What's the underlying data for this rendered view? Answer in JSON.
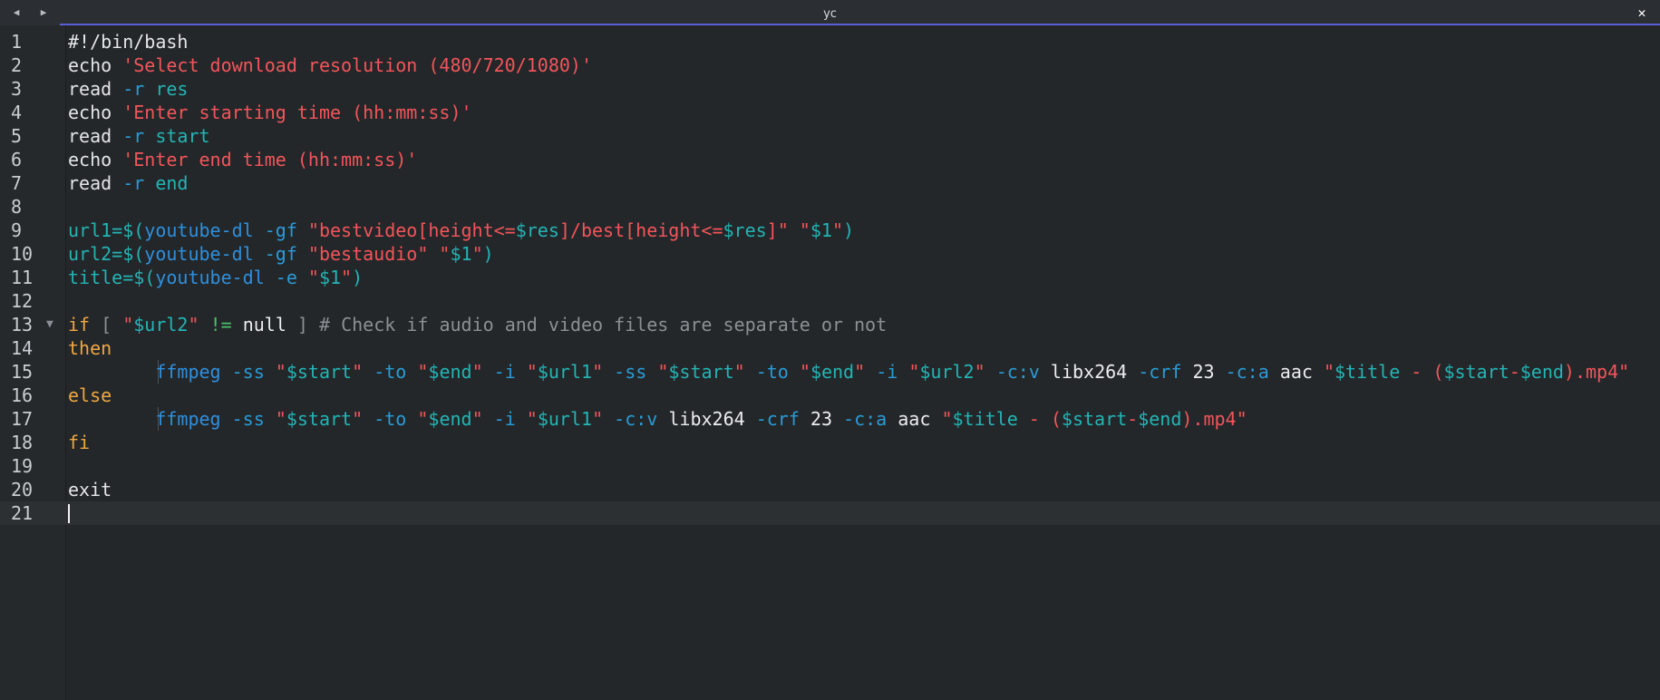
{
  "window": {
    "tab_title": "yc",
    "back_icon": "◀",
    "forward_icon": "▶",
    "close_icon": "✕"
  },
  "colors": {
    "keyword": "#f0a742",
    "string": "#f2555a",
    "variable": "#24b4b4",
    "builtin": "#2f8fdc",
    "option": "#2a9bd6",
    "comment": "#8b9095",
    "accent": "#5b5fd6"
  },
  "editor": {
    "current_line": 21,
    "lines": [
      {
        "n": "1",
        "tokens": [
          {
            "t": "#!/bin/bash",
            "c": "g"
          }
        ]
      },
      {
        "n": "2",
        "tokens": [
          {
            "t": "echo ",
            "c": "g"
          },
          {
            "t": "'Select download resolution (480/720/1080)'",
            "c": "s"
          }
        ]
      },
      {
        "n": "3",
        "tokens": [
          {
            "t": "read ",
            "c": "g"
          },
          {
            "t": "-r ",
            "c": "o"
          },
          {
            "t": "res",
            "c": "v"
          }
        ]
      },
      {
        "n": "4",
        "tokens": [
          {
            "t": "echo ",
            "c": "g"
          },
          {
            "t": "'Enter starting time (hh:mm:ss)'",
            "c": "s"
          }
        ]
      },
      {
        "n": "5",
        "tokens": [
          {
            "t": "read ",
            "c": "g"
          },
          {
            "t": "-r ",
            "c": "o"
          },
          {
            "t": "start",
            "c": "v"
          }
        ]
      },
      {
        "n": "6",
        "tokens": [
          {
            "t": "echo ",
            "c": "g"
          },
          {
            "t": "'Enter end time (hh:mm:ss)'",
            "c": "s"
          }
        ]
      },
      {
        "n": "7",
        "tokens": [
          {
            "t": "read ",
            "c": "g"
          },
          {
            "t": "-r ",
            "c": "o"
          },
          {
            "t": "end",
            "c": "v"
          }
        ]
      },
      {
        "n": "8",
        "tokens": []
      },
      {
        "n": "9",
        "tokens": [
          {
            "t": "url1=$(",
            "c": "v"
          },
          {
            "t": "youtube-dl ",
            "c": "b"
          },
          {
            "t": "-gf ",
            "c": "o"
          },
          {
            "t": "\"bestvideo[height<=",
            "c": "s"
          },
          {
            "t": "$res",
            "c": "v"
          },
          {
            "t": "]/best[height<=",
            "c": "s"
          },
          {
            "t": "$res",
            "c": "v"
          },
          {
            "t": "]\" \"",
            "c": "s"
          },
          {
            "t": "$1",
            "c": "v"
          },
          {
            "t": "\"",
            "c": "s"
          },
          {
            "t": ")",
            "c": "v"
          }
        ]
      },
      {
        "n": "10",
        "tokens": [
          {
            "t": "url2=$(",
            "c": "v"
          },
          {
            "t": "youtube-dl ",
            "c": "b"
          },
          {
            "t": "-gf ",
            "c": "o"
          },
          {
            "t": "\"bestaudio\" \"",
            "c": "s"
          },
          {
            "t": "$1",
            "c": "v"
          },
          {
            "t": "\"",
            "c": "s"
          },
          {
            "t": ")",
            "c": "v"
          }
        ]
      },
      {
        "n": "11",
        "tokens": [
          {
            "t": "title=$(",
            "c": "v"
          },
          {
            "t": "youtube-dl ",
            "c": "b"
          },
          {
            "t": "-e ",
            "c": "o"
          },
          {
            "t": "\"",
            "c": "s"
          },
          {
            "t": "$1",
            "c": "v"
          },
          {
            "t": "\"",
            "c": "s"
          },
          {
            "t": ")",
            "c": "v"
          }
        ]
      },
      {
        "n": "12",
        "tokens": []
      },
      {
        "n": "13",
        "fold": true,
        "tokens": [
          {
            "t": "if",
            "c": "k"
          },
          {
            "t": " [ ",
            "c": "c"
          },
          {
            "t": "\"",
            "c": "s"
          },
          {
            "t": "$url2",
            "c": "v"
          },
          {
            "t": "\" ",
            "c": "s"
          },
          {
            "t": "!= ",
            "c": "p"
          },
          {
            "t": "null",
            "c": "t"
          },
          {
            "t": " ] # Check if audio and video files are separate or not",
            "c": "c"
          }
        ]
      },
      {
        "n": "14",
        "tokens": [
          {
            "t": "then",
            "c": "k"
          }
        ]
      },
      {
        "n": "15",
        "guide": true,
        "tokens": [
          {
            "t": "\t",
            "c": "g"
          },
          {
            "t": "ffmpeg ",
            "c": "b"
          },
          {
            "t": "-ss ",
            "c": "o"
          },
          {
            "t": "\"",
            "c": "s"
          },
          {
            "t": "$start",
            "c": "v"
          },
          {
            "t": "\" ",
            "c": "s"
          },
          {
            "t": "-to ",
            "c": "o"
          },
          {
            "t": "\"",
            "c": "s"
          },
          {
            "t": "$end",
            "c": "v"
          },
          {
            "t": "\" ",
            "c": "s"
          },
          {
            "t": "-i ",
            "c": "o"
          },
          {
            "t": "\"",
            "c": "s"
          },
          {
            "t": "$url1",
            "c": "v"
          },
          {
            "t": "\" ",
            "c": "s"
          },
          {
            "t": "-ss ",
            "c": "o"
          },
          {
            "t": "\"",
            "c": "s"
          },
          {
            "t": "$start",
            "c": "v"
          },
          {
            "t": "\" ",
            "c": "s"
          },
          {
            "t": "-to ",
            "c": "o"
          },
          {
            "t": "\"",
            "c": "s"
          },
          {
            "t": "$end",
            "c": "v"
          },
          {
            "t": "\" ",
            "c": "s"
          },
          {
            "t": "-i ",
            "c": "o"
          },
          {
            "t": "\"",
            "c": "s"
          },
          {
            "t": "$url2",
            "c": "v"
          },
          {
            "t": "\" ",
            "c": "s"
          },
          {
            "t": "-c:v ",
            "c": "o"
          },
          {
            "t": "libx264 ",
            "c": "t"
          },
          {
            "t": "-crf ",
            "c": "o"
          },
          {
            "t": "23 ",
            "c": "t"
          },
          {
            "t": "-c:a ",
            "c": "o"
          },
          {
            "t": "aac ",
            "c": "t"
          },
          {
            "t": "\"",
            "c": "s"
          },
          {
            "t": "$title",
            "c": "v"
          },
          {
            "t": " - (",
            "c": "s"
          },
          {
            "t": "$start",
            "c": "v"
          },
          {
            "t": "-",
            "c": "s"
          },
          {
            "t": "$end",
            "c": "v"
          },
          {
            "t": ").mp4\"",
            "c": "s"
          }
        ]
      },
      {
        "n": "16",
        "tokens": [
          {
            "t": "else",
            "c": "k"
          }
        ]
      },
      {
        "n": "17",
        "guide": true,
        "tokens": [
          {
            "t": "\t",
            "c": "g"
          },
          {
            "t": "ffmpeg ",
            "c": "b"
          },
          {
            "t": "-ss ",
            "c": "o"
          },
          {
            "t": "\"",
            "c": "s"
          },
          {
            "t": "$start",
            "c": "v"
          },
          {
            "t": "\" ",
            "c": "s"
          },
          {
            "t": "-to ",
            "c": "o"
          },
          {
            "t": "\"",
            "c": "s"
          },
          {
            "t": "$end",
            "c": "v"
          },
          {
            "t": "\" ",
            "c": "s"
          },
          {
            "t": "-i ",
            "c": "o"
          },
          {
            "t": "\"",
            "c": "s"
          },
          {
            "t": "$url1",
            "c": "v"
          },
          {
            "t": "\" ",
            "c": "s"
          },
          {
            "t": "-c:v ",
            "c": "o"
          },
          {
            "t": "libx264 ",
            "c": "t"
          },
          {
            "t": "-crf ",
            "c": "o"
          },
          {
            "t": "23 ",
            "c": "t"
          },
          {
            "t": "-c:a ",
            "c": "o"
          },
          {
            "t": "aac ",
            "c": "t"
          },
          {
            "t": "\"",
            "c": "s"
          },
          {
            "t": "$title",
            "c": "v"
          },
          {
            "t": " - (",
            "c": "s"
          },
          {
            "t": "$start",
            "c": "v"
          },
          {
            "t": "-",
            "c": "s"
          },
          {
            "t": "$end",
            "c": "v"
          },
          {
            "t": ").mp4\"",
            "c": "s"
          }
        ]
      },
      {
        "n": "18",
        "tokens": [
          {
            "t": "fi",
            "c": "k"
          }
        ]
      },
      {
        "n": "19",
        "tokens": []
      },
      {
        "n": "20",
        "tokens": [
          {
            "t": "exit",
            "c": "g"
          }
        ]
      },
      {
        "n": "21",
        "tokens": []
      }
    ]
  }
}
